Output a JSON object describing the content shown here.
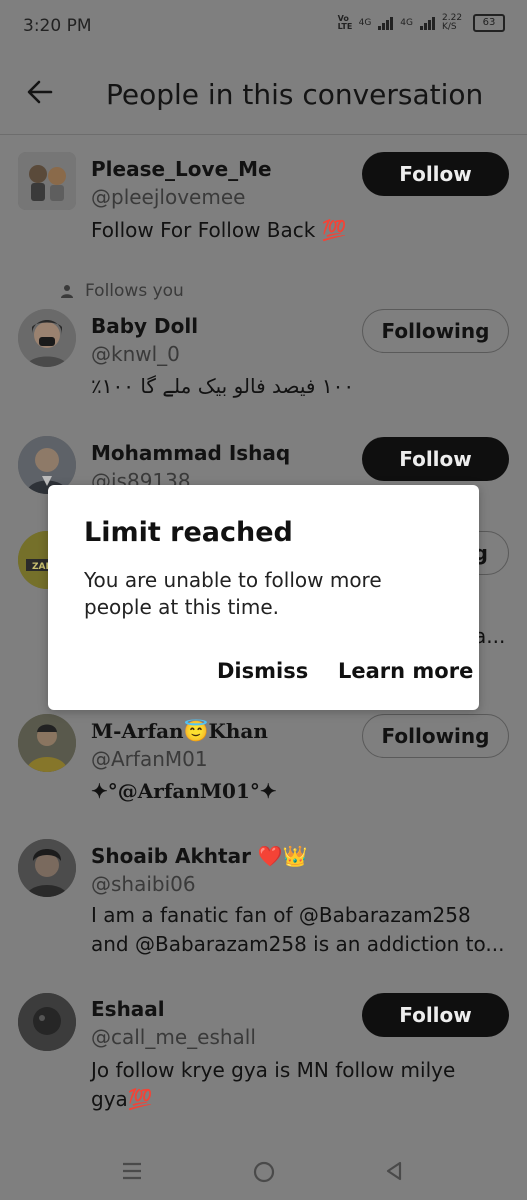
{
  "status_bar": {
    "time": "3:20 PM",
    "net1": "Vo LTE",
    "net2": "4G",
    "net3": "4G",
    "speed": "2.22 K/S",
    "battery": "63"
  },
  "header": {
    "title": "People in this conversation",
    "back_icon": "arrow-left-icon"
  },
  "users": [
    {
      "name": "Please_Love_Me",
      "handle": "@pleejlovemee",
      "bio": "Follow For Follow Back 💯",
      "button": "Follow"
    },
    {
      "name": "Baby Doll",
      "handle": "@knwl_0",
      "bio": "١٠٠ فیصد فالو بیک ملے گا ١٠٠٪",
      "button": "Following",
      "follows_you": "Follows you"
    },
    {
      "name": "Mohammad Ishaq",
      "handle": "@is89138",
      "button": "Follow"
    },
    {
      "name": "M-Arfan😇Khan",
      "handle": "@ArfanM01",
      "bio": "✦°@ArfanM01°✦",
      "button": "Following"
    },
    {
      "name": "Shoaib Akhtar ❤️👑",
      "handle": "@shaibi06",
      "bio": "I am a fanatic fan of @Babarazam258 and @Babarazam258 is an addiction to...",
      "button": ""
    },
    {
      "name": "Eshaal",
      "handle": "@call_me_eshall",
      "bio": "Jo follow krye gya is MN follow milye gya💯",
      "button": "Follow"
    }
  ],
  "partial": {
    "button_fragment": "g",
    "bio_fragment": "a..."
  },
  "dialog": {
    "title": "Limit reached",
    "message": "You are unable to follow more people at this time.",
    "dismiss": "Dismiss",
    "learn_more": "Learn more"
  },
  "nav": {
    "menu_icon": "menu-icon",
    "home_icon": "home-circle-icon",
    "back_icon": "back-triangle-icon"
  }
}
